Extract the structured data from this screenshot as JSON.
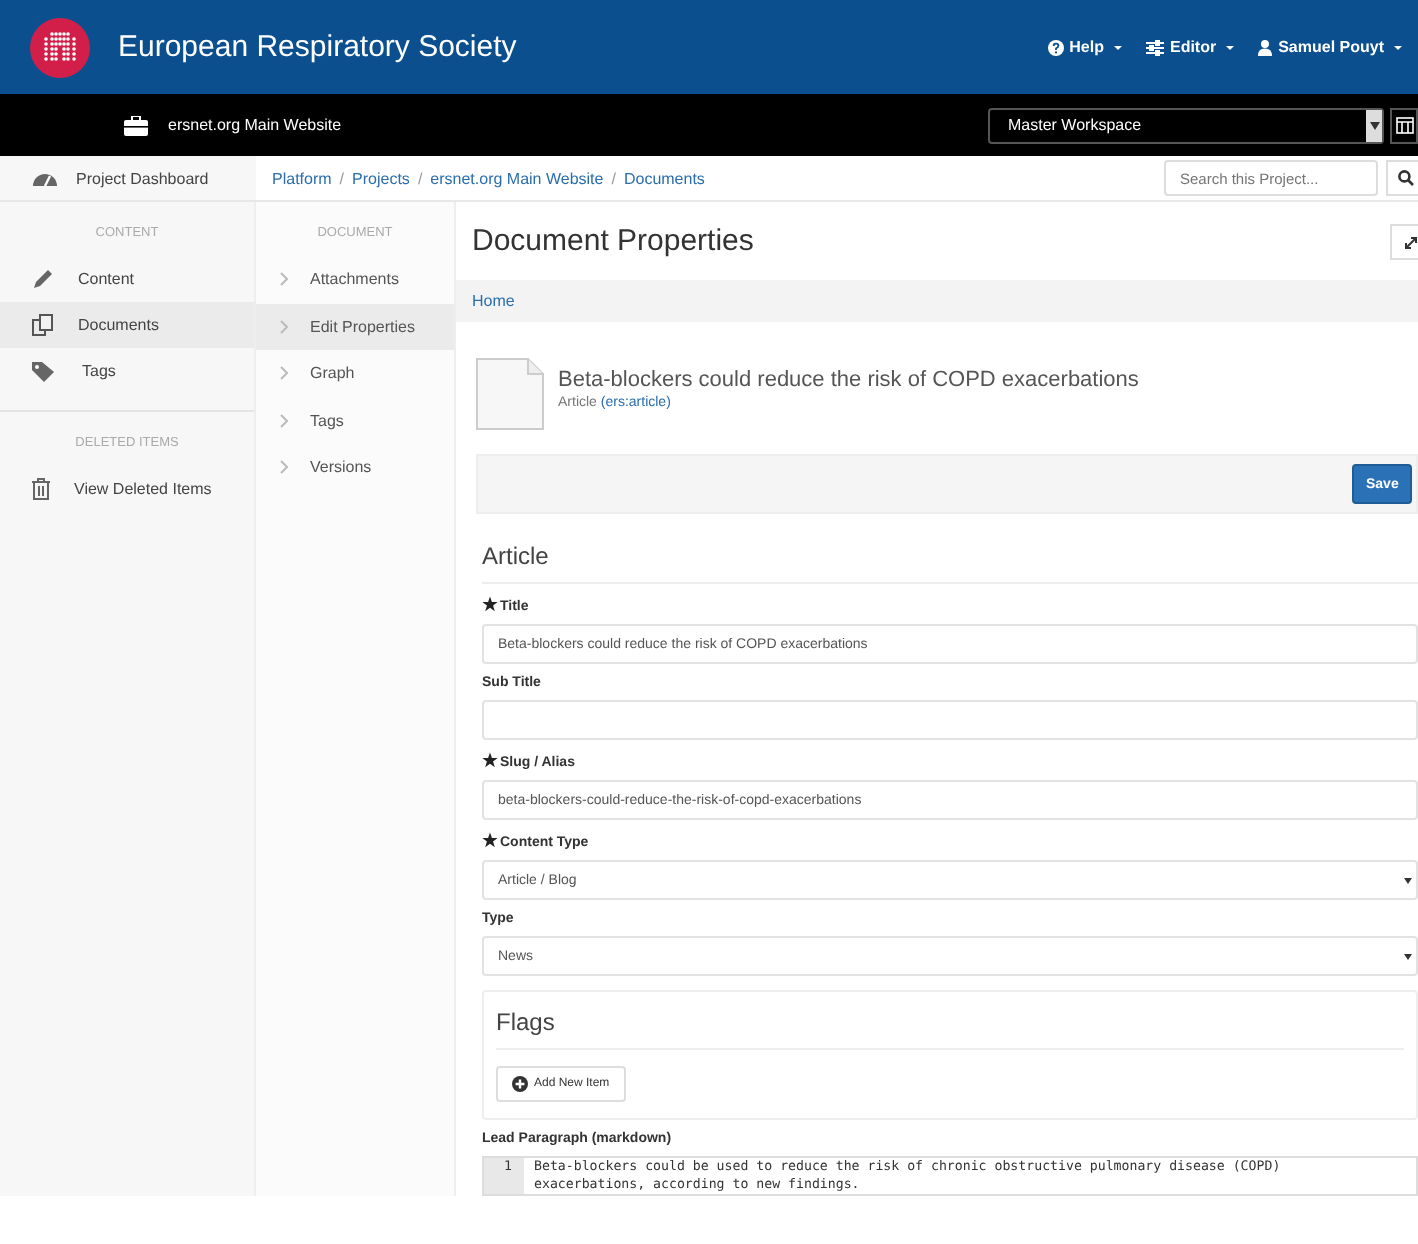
{
  "header": {
    "title": "European Respiratory Society",
    "menus": [
      {
        "kind": "help",
        "label": "Help"
      },
      {
        "kind": "editor",
        "label": "Editor"
      },
      {
        "kind": "user",
        "label": "Samuel Pouyt"
      }
    ]
  },
  "project_bar": {
    "project": "ersnet.org Main Website",
    "workspace": "Master Workspace"
  },
  "sidebar": {
    "top": "Project Dashboard",
    "sections": [
      {
        "heading": "CONTENT",
        "items": [
          {
            "kind": "pencil",
            "label": "Content",
            "selected": false
          },
          {
            "kind": "documents",
            "label": "Documents",
            "selected": true
          },
          {
            "kind": "tags",
            "label": "Tags",
            "selected": false
          }
        ]
      },
      {
        "heading": "DELETED ITEMS",
        "items": [
          {
            "kind": "trash",
            "label": "View Deleted Items",
            "selected": false
          }
        ]
      }
    ]
  },
  "breadcrumb": {
    "separator": "/",
    "items": [
      "Platform",
      "Projects",
      "ersnet.org Main Website",
      "Documents"
    ]
  },
  "search": {
    "placeholder": "Search this Project..."
  },
  "document_nav": {
    "heading": "DOCUMENT",
    "items": [
      {
        "label": "Attachments",
        "selected": false
      },
      {
        "label": "Edit Properties",
        "selected": true
      },
      {
        "label": "Graph",
        "selected": false
      },
      {
        "label": "Tags",
        "selected": false
      },
      {
        "label": "Versions",
        "selected": false
      }
    ]
  },
  "page_title": "Document Properties",
  "path": "Home",
  "document": {
    "title": "Beta-blockers could reduce the risk of COPD exacerbations",
    "type": "Article",
    "type_id": "(ers:article)"
  },
  "save_button": "Save",
  "form": {
    "heading": "Article",
    "fields": [
      {
        "kind": "text",
        "label": "Title",
        "required": true,
        "value": "Beta-blockers could reduce the risk of COPD exacerbations"
      },
      {
        "kind": "text",
        "label": "Sub Title",
        "required": false
      },
      {
        "kind": "text",
        "label": "Slug / Alias",
        "required": true,
        "value": "beta-blockers-could-reduce-the-risk-of-copd-exacerbations"
      },
      {
        "kind": "select",
        "label": "Content Type",
        "required": true,
        "value": "Article / Blog"
      },
      {
        "kind": "select",
        "label": "Type",
        "required": false,
        "value": "News"
      }
    ],
    "flags": {
      "heading": "Flags",
      "add_button": "Add New Item"
    },
    "lead": {
      "label": "Lead Paragraph (markdown)",
      "lines": [
        {
          "number": "1",
          "text": "Beta-blockers could be used to reduce the risk of chronic obstructive pulmonary disease (COPD) exacerbations, according to new findings."
        }
      ]
    }
  }
}
